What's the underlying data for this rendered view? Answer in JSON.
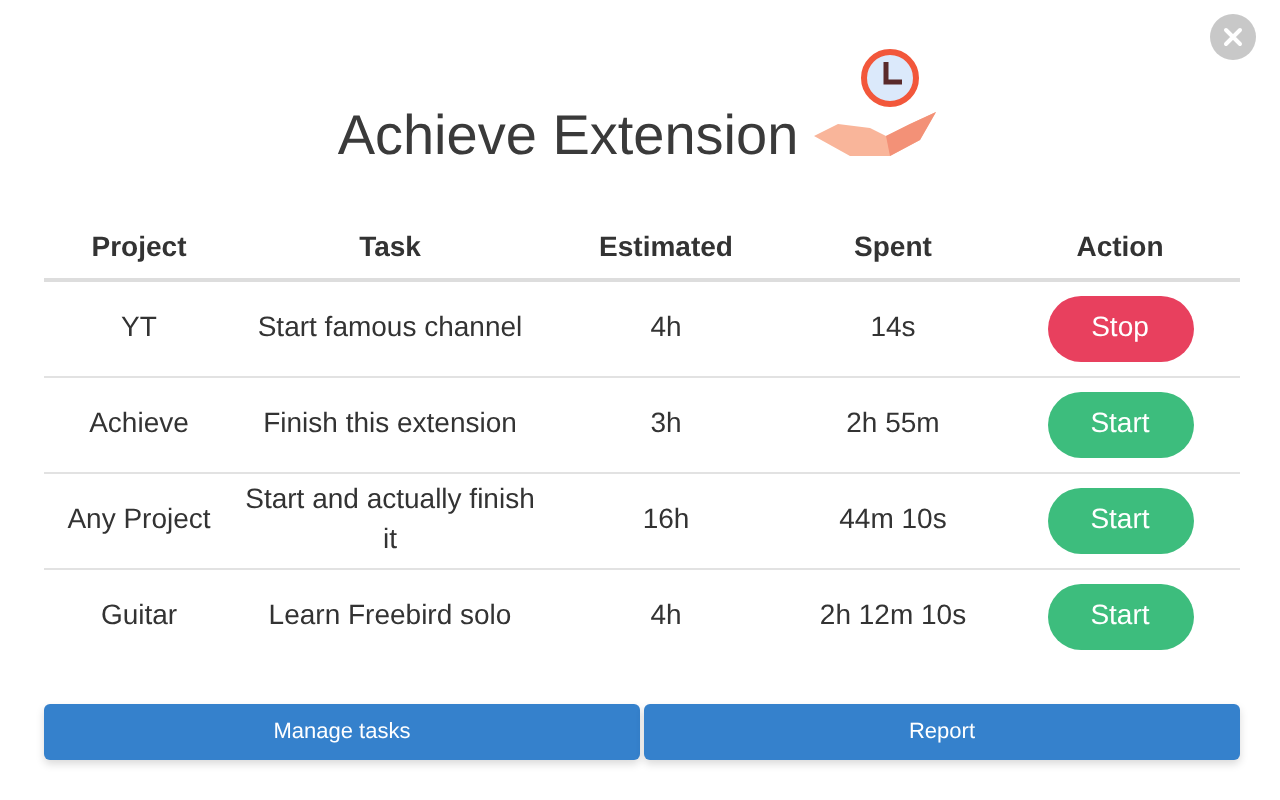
{
  "title": "Achieve Extension",
  "table": {
    "columns": [
      "Project",
      "Task",
      "Estimated",
      "Spent",
      "Action"
    ],
    "rows": [
      {
        "project": "YT",
        "task": "Start famous channel",
        "estimated": "4h",
        "spent": "14s",
        "action": "Stop",
        "running": true
      },
      {
        "project": "Achieve",
        "task": "Finish this extension",
        "estimated": "3h",
        "spent": "2h 55m",
        "action": "Start",
        "running": false
      },
      {
        "project": "Any Project",
        "task": "Start and actually finish it",
        "estimated": "16h",
        "spent": "44m 10s",
        "action": "Start",
        "running": false
      },
      {
        "project": "Guitar",
        "task": "Learn Freebird solo",
        "estimated": "4h",
        "spent": "2h 12m 10s",
        "action": "Start",
        "running": false
      }
    ]
  },
  "buttons": [
    "Manage tasks",
    "Report"
  ]
}
